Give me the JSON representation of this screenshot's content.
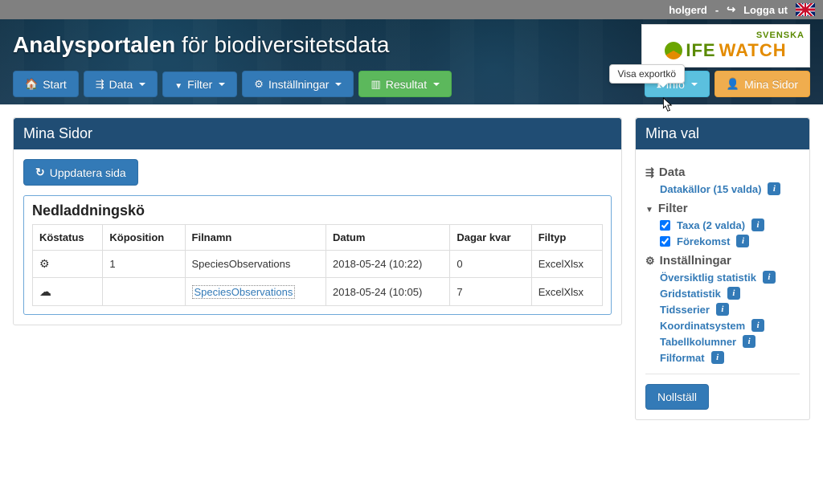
{
  "topbar": {
    "username": "holgerd",
    "separator": " - ",
    "logout": "Logga ut"
  },
  "banner": {
    "title_bold": "Analysportalen",
    "title_rest": " för biodiversitetsdata"
  },
  "logo": {
    "svenska": "SVENSKA",
    "ife": "IFE",
    "watch": "WATCH"
  },
  "tooltip": "Visa exportkö",
  "nav": {
    "start": "Start",
    "data": "Data",
    "filter": "Filter",
    "settings": "Inställningar",
    "result": "Resultat",
    "info": "Info",
    "mypages": "Mina Sidor"
  },
  "main": {
    "heading": "Mina Sidor",
    "refresh": "Uppdatera sida",
    "queue_title": "Nedladdningskö",
    "columns": {
      "status": "Köstatus",
      "position": "Köposition",
      "filename": "Filnamn",
      "date": "Datum",
      "days": "Dagar kvar",
      "filetype": "Filtyp"
    },
    "rows": [
      {
        "status_icon": "gear",
        "position": "1",
        "filename": "SpeciesObservations",
        "filename_link": false,
        "date": "2018-05-24 (10:22)",
        "days": "0",
        "filetype": "ExcelXlsx"
      },
      {
        "status_icon": "cloud",
        "position": "",
        "filename": "SpeciesObservations",
        "filename_link": true,
        "date": "2018-05-24 (10:05)",
        "days": "7",
        "filetype": "ExcelXlsx"
      }
    ]
  },
  "sidebar": {
    "heading": "Mina val",
    "data_section": "Data",
    "data_items": [
      {
        "label": "Datakällor (15 valda)",
        "checkbox": false
      }
    ],
    "filter_section": "Filter",
    "filter_items": [
      {
        "label": "Taxa (2 valda)",
        "checkbox": true,
        "checked": true
      },
      {
        "label": "Förekomst",
        "checkbox": true,
        "checked": true
      }
    ],
    "settings_section": "Inställningar",
    "settings_items": [
      {
        "label": "Översiktlig statistik"
      },
      {
        "label": "Gridstatistik"
      },
      {
        "label": "Tidsserier"
      },
      {
        "label": "Koordinatsystem"
      },
      {
        "label": "Tabellkolumner"
      },
      {
        "label": "Filformat"
      }
    ],
    "reset": "Nollställ"
  }
}
